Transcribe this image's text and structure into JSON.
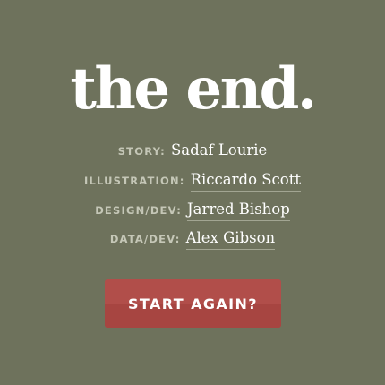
{
  "title": "the end.",
  "credits": [
    {
      "role": "STORY:",
      "name": "Sadaf Lourie"
    },
    {
      "role": "ILLUSTRATION:",
      "name": "Riccardo Scott"
    },
    {
      "role": "DESIGN/DEV:",
      "name": "Jarred Bishop"
    },
    {
      "role": "DATA/DEV:",
      "name": "Alex Gibson"
    }
  ],
  "restart_label": "START AGAIN?",
  "colors": {
    "background": "#6e725c",
    "button": "#b14e4a"
  }
}
